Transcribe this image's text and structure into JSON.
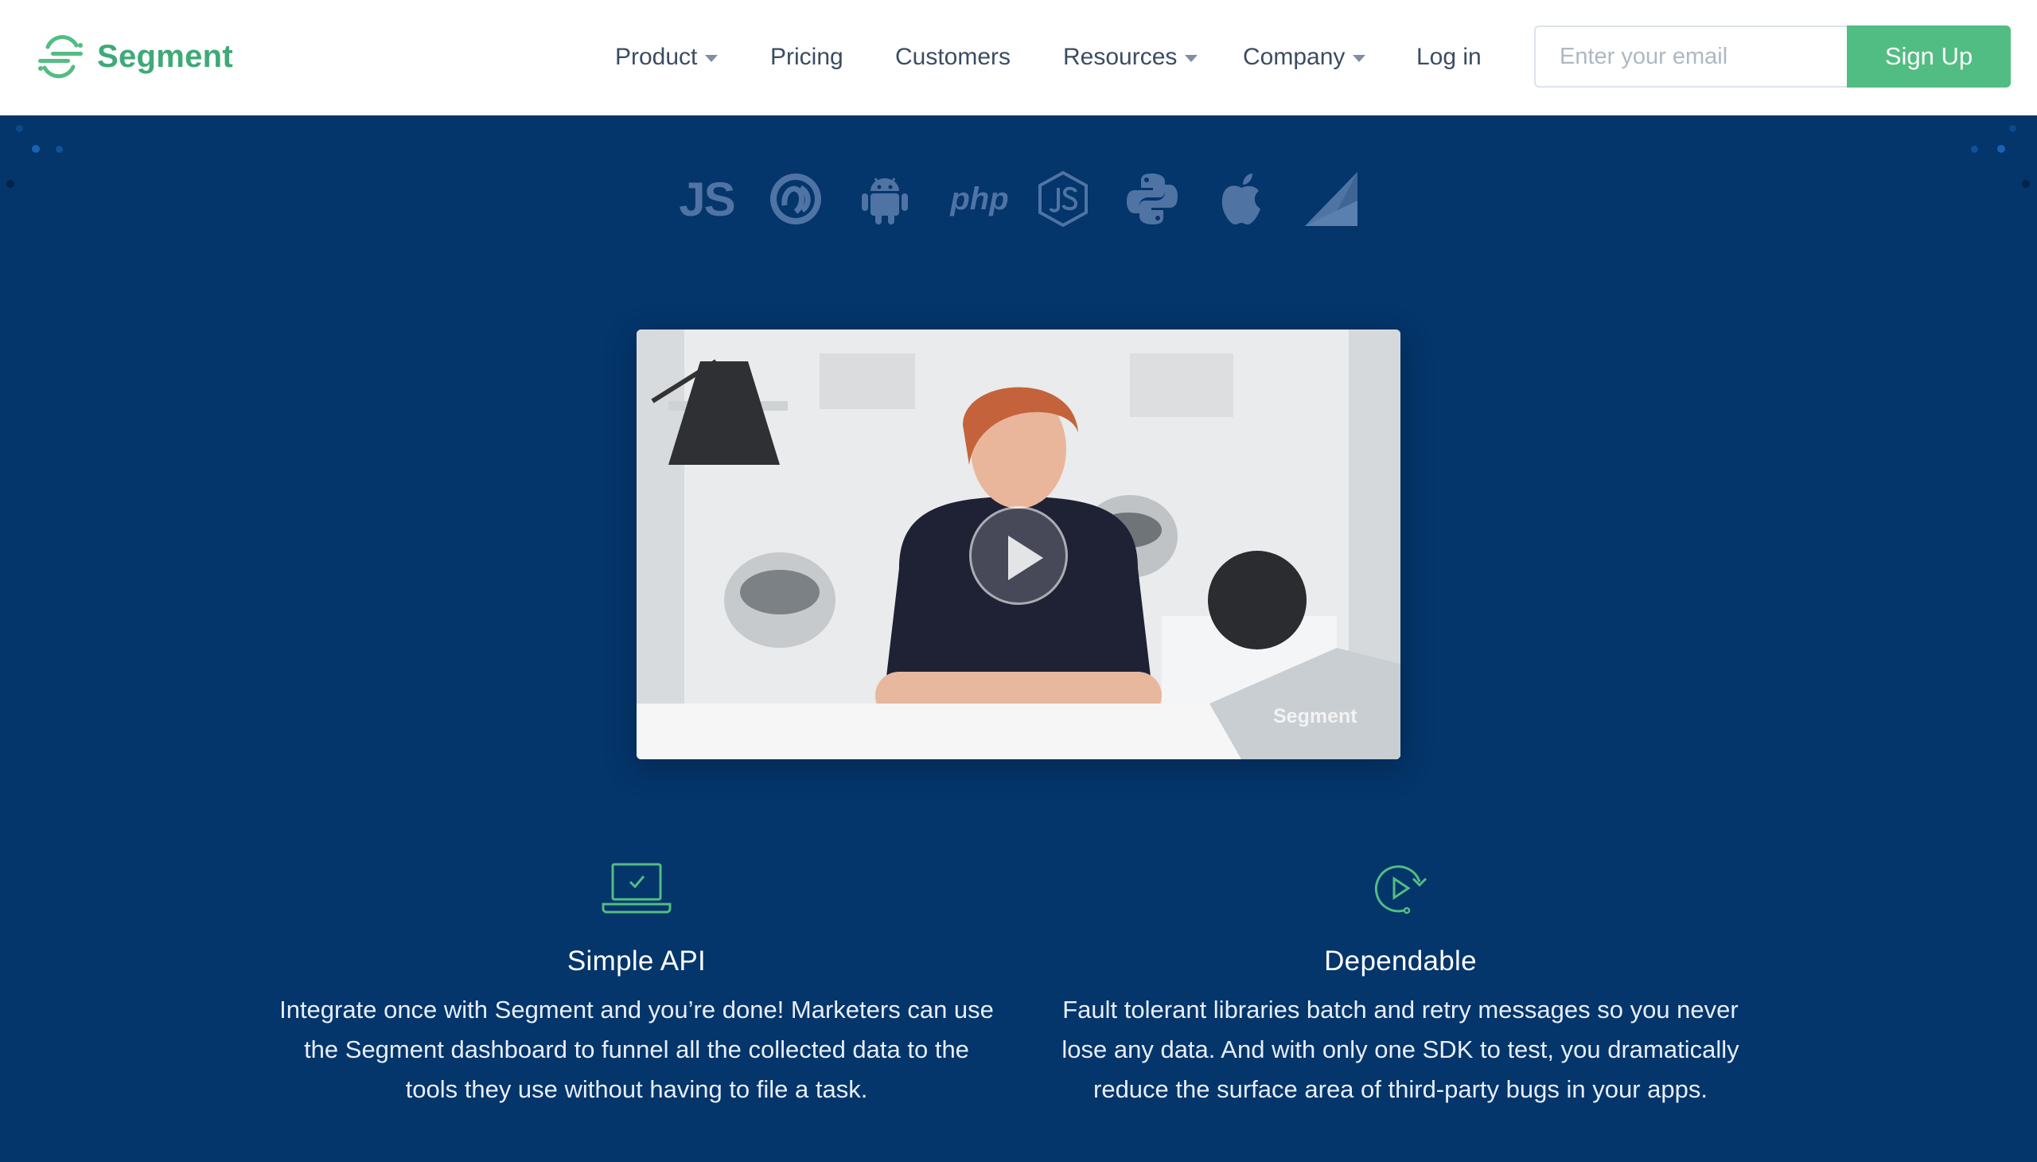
{
  "brand": {
    "name": "Segment",
    "accent_color": "#52bd83"
  },
  "nav": {
    "items": [
      {
        "label": "Product",
        "has_dropdown": true
      },
      {
        "label": "Pricing",
        "has_dropdown": false
      },
      {
        "label": "Customers",
        "has_dropdown": false
      },
      {
        "label": "Resources",
        "has_dropdown": true
      },
      {
        "label": "Company",
        "has_dropdown": true
      },
      {
        "label": "Log in",
        "has_dropdown": false
      }
    ]
  },
  "signup": {
    "email_placeholder": "Enter your email",
    "button_label": "Sign Up"
  },
  "libraries": [
    {
      "name": "javascript",
      "icon": "js-text",
      "text": "JS"
    },
    {
      "name": "clojure",
      "icon": "clojure-icon"
    },
    {
      "name": "android",
      "icon": "android-icon"
    },
    {
      "name": "php",
      "icon": "php-text",
      "text": "php"
    },
    {
      "name": "nodejs",
      "icon": "nodejs-icon"
    },
    {
      "name": "python",
      "icon": "python-icon"
    },
    {
      "name": "ios",
      "icon": "apple-icon"
    },
    {
      "name": "xamarin",
      "icon": "xamarin-icon"
    }
  ],
  "video": {
    "watermark": "Segment"
  },
  "features": [
    {
      "icon": "laptop-check-icon",
      "title": "Simple API",
      "description": "Integrate once with Segment and you’re done! Marketers can use the Segment dashboard to funnel all the collected data to the tools they use without having to file a task."
    },
    {
      "icon": "play-retry-icon",
      "title": "Dependable",
      "description": "Fault tolerant libraries batch and retry messages so you never lose any data. And with only one SDK to test, you dramatically reduce the surface area of third-party bugs in your apps."
    }
  ],
  "colors": {
    "background": "#04356b",
    "nav_text": "#3b4c63",
    "icon_muted": "#4f74a4"
  }
}
